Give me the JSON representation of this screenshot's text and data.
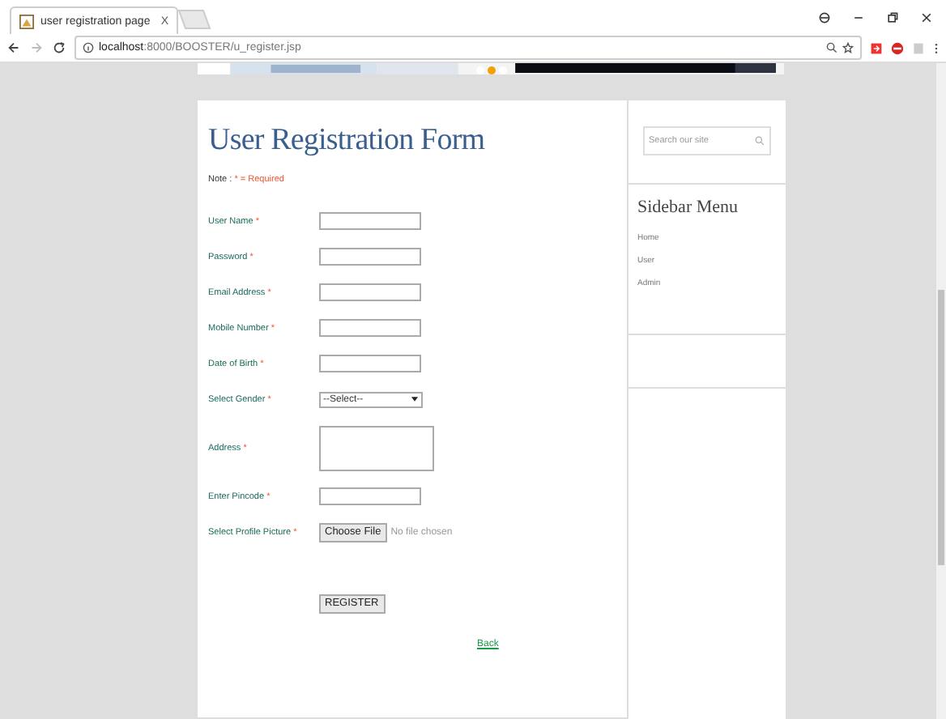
{
  "browser": {
    "tab_title": "user registration page",
    "tab_close": "X",
    "url_host": "localhost",
    "url_path": ":8000/BOOSTER/u_register.jsp"
  },
  "banner": {
    "kind": "picture",
    "slides": [
      {
        "selected": false
      },
      {
        "selected": true
      },
      {
        "selected": false
      }
    ]
  },
  "form": {
    "title": "User Registration Form",
    "note_label": "Note : ",
    "note_text": "* = Required",
    "fields": [
      {
        "label": "User Name",
        "required_mark": "*",
        "kind": "text"
      },
      {
        "label": "Password",
        "required_mark": "*",
        "kind": "text"
      },
      {
        "label": "Email Address",
        "required_mark": "*",
        "kind": "text"
      },
      {
        "label": "Mobile Number",
        "required_mark": "*",
        "kind": "text"
      },
      {
        "label": "Date of Birth",
        "required_mark": "*",
        "kind": "text"
      },
      {
        "label": "Select Gender",
        "required_mark": "*",
        "kind": "select",
        "value": "--Select--"
      },
      {
        "label": "Address",
        "required_mark": "*",
        "kind": "textarea"
      },
      {
        "label": "Enter Pincode",
        "required_mark": "*",
        "kind": "text"
      },
      {
        "label": "Select Profile Picture",
        "required_mark": "*",
        "kind": "file",
        "button": "Choose File",
        "status": "No file chosen"
      }
    ],
    "submit": "REGISTER",
    "back_link": "Back"
  },
  "sidebar": {
    "search_placeholder": "Search our site",
    "title": "Sidebar Menu",
    "items": [
      "Home",
      "User",
      "Admin"
    ]
  }
}
